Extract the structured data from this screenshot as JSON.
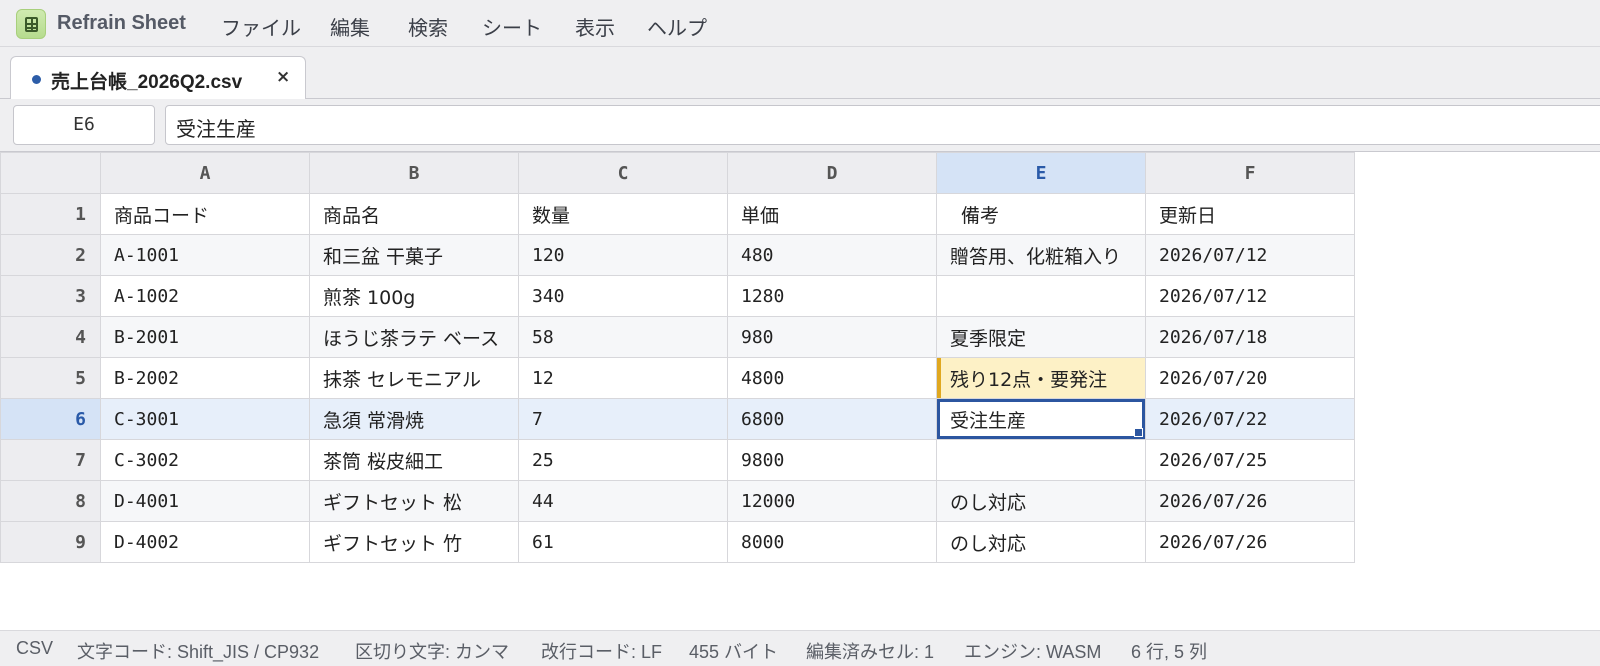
{
  "app": {
    "name": "Refrain Sheet"
  },
  "menu": [
    "ファイル",
    "編集",
    "検索",
    "シート",
    "表示",
    "ヘルプ"
  ],
  "tab": {
    "label": "売上台帳_2026Q2.csv",
    "close": "×",
    "modified": true
  },
  "formula": {
    "cell_ref": "E6",
    "value": "受注生産"
  },
  "columns": [
    "A",
    "B",
    "C",
    "D",
    "E",
    "F"
  ],
  "rows": [
    {
      "num": "1",
      "cells": [
        "商品コード",
        "商品名",
        "数量",
        "単価",
        "備考",
        "更新日"
      ]
    },
    {
      "num": "2",
      "cells": [
        "A-1001",
        "和三盆 干菓子",
        "120",
        "480",
        "贈答用、化粧箱入り",
        "2026/07/12"
      ]
    },
    {
      "num": "3",
      "cells": [
        "A-1002",
        "煎茶 100g",
        "340",
        "1280",
        "",
        "2026/07/12"
      ]
    },
    {
      "num": "4",
      "cells": [
        "B-2001",
        "ほうじ茶ラテ ベース",
        "58",
        "980",
        "夏季限定",
        "2026/07/18"
      ]
    },
    {
      "num": "5",
      "cells": [
        "B-2002",
        "抹茶 セレモニアル",
        "12",
        "4800",
        "残り12点・要発注",
        "2026/07/20"
      ]
    },
    {
      "num": "6",
      "cells": [
        "C-3001",
        "急須 常滑焼",
        "7",
        "6800",
        "受注生産",
        "2026/07/22"
      ]
    },
    {
      "num": "7",
      "cells": [
        "C-3002",
        "茶筒 桜皮細工",
        "25",
        "9800",
        "",
        "2026/07/25"
      ]
    },
    {
      "num": "8",
      "cells": [
        "D-4001",
        "ギフトセット 松",
        "44",
        "12000",
        "のし対応",
        "2026/07/26"
      ]
    },
    {
      "num": "9",
      "cells": [
        "D-4002",
        "ギフトセット 竹",
        "61",
        "8000",
        "のし対応",
        "2026/07/26"
      ]
    }
  ],
  "status": [
    "CSV",
    "文字コード: Shift_JIS / CP932",
    "区切り文字: カンマ",
    "改行コード: LF",
    "455 バイト",
    "編集済みセル: 1",
    "エンジン: WASM",
    "6 行, 5 列"
  ],
  "colors": {
    "accent": "#2c56a0",
    "warning": "#fdf1c6",
    "selection": "#e7effa"
  },
  "icons": {
    "app_logo": "spreadsheet-icon",
    "tab_dot": "unsaved-dot-icon",
    "tab_close": "close-icon"
  }
}
